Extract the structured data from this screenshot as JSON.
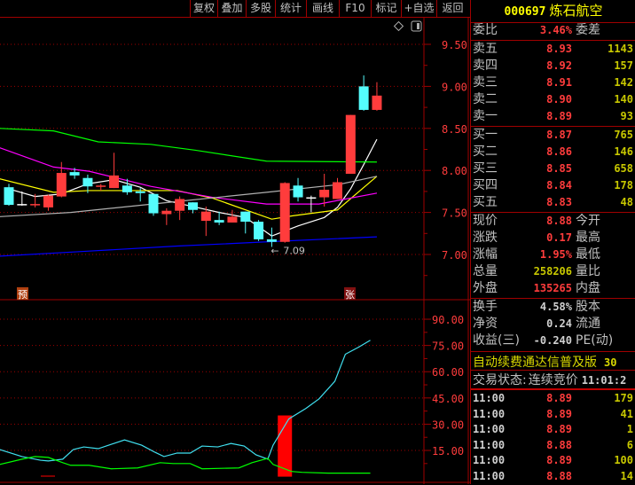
{
  "toolbar": {
    "buttons": [
      "复权",
      "叠加",
      "多股",
      "统计",
      "画线",
      "F10",
      "标记",
      "+自选",
      "返回"
    ]
  },
  "stock": {
    "code": "000697",
    "name": "炼石航空"
  },
  "weibi": {
    "label": "委比",
    "value": "3.46%",
    "label2": "委差"
  },
  "asks": [
    {
      "label": "卖五",
      "price": "8.93",
      "vol": "1143"
    },
    {
      "label": "卖四",
      "price": "8.92",
      "vol": "157"
    },
    {
      "label": "卖三",
      "price": "8.91",
      "vol": "142"
    },
    {
      "label": "卖二",
      "price": "8.90",
      "vol": "140"
    },
    {
      "label": "卖一",
      "price": "8.89",
      "vol": "93"
    }
  ],
  "bids": [
    {
      "label": "买一",
      "price": "8.87",
      "vol": "765"
    },
    {
      "label": "买二",
      "price": "8.86",
      "vol": "146"
    },
    {
      "label": "买三",
      "price": "8.85",
      "vol": "658"
    },
    {
      "label": "买四",
      "price": "8.84",
      "vol": "178"
    },
    {
      "label": "买五",
      "price": "8.83",
      "vol": "48"
    }
  ],
  "quote": [
    {
      "label": "现价",
      "value": "8.88",
      "label2": "今开",
      "color": "red"
    },
    {
      "label": "涨跌",
      "value": "0.17",
      "label2": "最高",
      "color": "red"
    },
    {
      "label": "涨幅",
      "value": "1.95%",
      "label2": "最低",
      "color": "red"
    },
    {
      "label": "总量",
      "value": "258206",
      "label2": "量比",
      "color": "yellow"
    },
    {
      "label": "外盘",
      "value": "135265",
      "label2": "内盘",
      "color": "red"
    }
  ],
  "fund": [
    {
      "label": "换手",
      "value": "4.58%",
      "label2": "股本"
    },
    {
      "label": "净资",
      "value": "0.24",
      "label2": "流通"
    },
    {
      "label": "收益(三)",
      "value": "-0.240",
      "label2": "PE(动)"
    }
  ],
  "promo": {
    "text": "自动续费通达信普及版",
    "extra": "30"
  },
  "status": {
    "label": "交易状态:",
    "value": "连续竞价",
    "time": "11:01:2"
  },
  "ticks": [
    {
      "time": "11:00",
      "price": "8.89",
      "vol": "179"
    },
    {
      "time": "11:00",
      "price": "8.89",
      "vol": "41"
    },
    {
      "time": "11:00",
      "price": "8.89",
      "vol": "1"
    },
    {
      "time": "11:00",
      "price": "8.88",
      "vol": "6"
    },
    {
      "time": "11:00",
      "price": "8.89",
      "vol": "100"
    },
    {
      "time": "11:00",
      "price": "8.88",
      "vol": "14"
    }
  ],
  "markers": {
    "left": "预",
    "right": "张",
    "low_label": "7.09"
  },
  "chart_data": [
    {
      "type": "candlestick",
      "name": "price",
      "ylim": [
        6.85,
        9.6
      ],
      "yticks": [
        "9.50",
        "9.00",
        "8.50",
        "8.00",
        "7.50",
        "7.00"
      ],
      "colors": {
        "up": "#ff3c3c",
        "down": "#54fcfc",
        "flat": "#ffffff"
      },
      "candles": [
        [
          7.8,
          7.59,
          7.84,
          7.58
        ],
        [
          7.6,
          7.6,
          7.75,
          7.58
        ],
        [
          7.6,
          7.6,
          7.72,
          7.56
        ],
        [
          7.56,
          7.7,
          7.71,
          7.52
        ],
        [
          7.69,
          7.97,
          8.1,
          7.68
        ],
        [
          7.98,
          7.94,
          8.03,
          7.9
        ],
        [
          7.91,
          7.81,
          7.95,
          7.73
        ],
        [
          7.81,
          7.82,
          7.84,
          7.76
        ],
        [
          7.79,
          7.94,
          8.21,
          7.79
        ],
        [
          7.82,
          7.74,
          7.9,
          7.71
        ],
        [
          7.75,
          7.73,
          7.79,
          7.63
        ],
        [
          7.72,
          7.49,
          7.72,
          7.46
        ],
        [
          7.48,
          7.52,
          7.55,
          7.35
        ],
        [
          7.52,
          7.66,
          7.69,
          7.41
        ],
        [
          7.62,
          7.53,
          7.62,
          7.49
        ],
        [
          7.4,
          7.51,
          7.57,
          7.22
        ],
        [
          7.41,
          7.38,
          7.51,
          7.35
        ],
        [
          7.38,
          7.45,
          7.53,
          7.38
        ],
        [
          7.51,
          7.39,
          7.51,
          7.25
        ],
        [
          7.39,
          7.18,
          7.41,
          7.16
        ],
        [
          7.18,
          7.15,
          7.32,
          7.09
        ],
        [
          7.15,
          7.85,
          7.86,
          7.14
        ],
        [
          7.82,
          7.68,
          7.91,
          7.63
        ],
        [
          7.68,
          7.68,
          7.7,
          7.5
        ],
        [
          7.68,
          7.77,
          7.96,
          7.57
        ],
        [
          7.66,
          7.86,
          7.91,
          7.66
        ],
        [
          7.96,
          8.66,
          8.66,
          7.96
        ],
        [
          9.0,
          8.72,
          9.13,
          8.71
        ],
        [
          8.72,
          8.89,
          9.05,
          8.71
        ]
      ],
      "lines": [
        {
          "name": "MA5",
          "color": "#ffffff",
          "points": [
            [
              0,
              7.78
            ],
            [
              2,
              7.69
            ],
            [
              4,
              7.72
            ],
            [
              6,
              7.84
            ],
            [
              8,
              7.89
            ],
            [
              10,
              7.8
            ],
            [
              12,
              7.64
            ],
            [
              14,
              7.57
            ],
            [
              16,
              7.5
            ],
            [
              18,
              7.44
            ],
            [
              20,
              7.22
            ],
            [
              22,
              7.34
            ],
            [
              24,
              7.44
            ],
            [
              25,
              7.56
            ],
            [
              26,
              7.78
            ],
            [
              27,
              8.07
            ],
            [
              28,
              8.37
            ]
          ]
        },
        {
          "name": "MA10",
          "color": "#ffff00",
          "points": [
            [
              -0.7,
              7.9
            ],
            [
              3.4,
              7.74
            ],
            [
              6.1,
              7.76
            ],
            [
              12.8,
              7.76
            ],
            [
              15.5,
              7.67
            ],
            [
              20,
              7.42
            ],
            [
              21.6,
              7.46
            ],
            [
              25,
              7.53
            ],
            [
              28,
              7.93
            ]
          ]
        },
        {
          "name": "MA20",
          "color": "#ff00ff",
          "points": [
            [
              -0.7,
              8.27
            ],
            [
              3.4,
              8.04
            ],
            [
              6.1,
              7.99
            ],
            [
              10.8,
              7.81
            ],
            [
              15.5,
              7.68
            ],
            [
              19.6,
              7.6
            ],
            [
              23.6,
              7.6
            ],
            [
              28,
              7.73
            ]
          ]
        },
        {
          "name": "MA30",
          "color": "#b0b0b0",
          "points": [
            [
              -0.7,
              7.45
            ],
            [
              4.7,
              7.5
            ],
            [
              12.8,
              7.63
            ],
            [
              19.6,
              7.74
            ],
            [
              25,
              7.83
            ],
            [
              28,
              7.93
            ]
          ]
        },
        {
          "name": "MA60",
          "color": "#00ff00",
          "points": [
            [
              -0.7,
              8.5
            ],
            [
              3.4,
              8.47
            ],
            [
              6.8,
              8.34
            ],
            [
              10.8,
              8.31
            ],
            [
              14.2,
              8.24
            ],
            [
              19.6,
              8.11
            ],
            [
              28,
              8.1
            ]
          ]
        },
        {
          "name": "MA120",
          "color": "#0000ff",
          "points": [
            [
              -0.7,
              6.98
            ],
            [
              6.1,
              7.04
            ],
            [
              12.8,
              7.1
            ],
            [
              19.6,
              7.15
            ],
            [
              28,
              7.21
            ]
          ]
        }
      ]
    },
    {
      "type": "line",
      "name": "indicator",
      "ylim": [
        0,
        100
      ],
      "yticks": [
        "90.00",
        "75.00",
        "60.00",
        "45.00",
        "30.00",
        "15.00"
      ],
      "bar": {
        "index": 21,
        "value": 35,
        "color": "#ff0000"
      },
      "series": [
        {
          "name": "cyan",
          "color": "#40e0f0",
          "points": [
            [
              -0.7,
              15.5
            ],
            [
              1,
              11.5
            ],
            [
              2.4,
              9.4
            ],
            [
              3,
              9
            ],
            [
              4.1,
              10
            ],
            [
              4.9,
              15.5
            ],
            [
              5.7,
              17
            ],
            [
              6.8,
              16
            ],
            [
              7.8,
              18.5
            ],
            [
              8.8,
              21
            ],
            [
              10.1,
              18
            ],
            [
              11.1,
              14
            ],
            [
              11.8,
              11.5
            ],
            [
              12.8,
              13.5
            ],
            [
              13.8,
              13.5
            ],
            [
              14.7,
              17.5
            ],
            [
              15.9,
              17
            ],
            [
              16.9,
              19
            ],
            [
              17.9,
              17.5
            ],
            [
              18.8,
              12.5
            ],
            [
              19.7,
              10
            ],
            [
              20.1,
              18
            ],
            [
              21.3,
              33
            ],
            [
              22.6,
              39
            ],
            [
              23.6,
              44.5
            ],
            [
              24.8,
              54.5
            ],
            [
              25.6,
              70
            ],
            [
              26.6,
              74
            ],
            [
              27.5,
              78
            ]
          ]
        },
        {
          "name": "green",
          "color": "#00ff00",
          "points": [
            [
              -0.7,
              7
            ],
            [
              1,
              10
            ],
            [
              2,
              11.5
            ],
            [
              3,
              11
            ],
            [
              4.1,
              8
            ],
            [
              4.7,
              6.5
            ],
            [
              6.1,
              6.5
            ],
            [
              7.8,
              4.5
            ],
            [
              9.8,
              5
            ],
            [
              11.5,
              8
            ],
            [
              12.5,
              7.5
            ],
            [
              13.8,
              7.5
            ],
            [
              14.7,
              4.5
            ],
            [
              17.5,
              5
            ],
            [
              18.5,
              8
            ],
            [
              19.7,
              10.5
            ],
            [
              20.1,
              7
            ],
            [
              21.5,
              3
            ],
            [
              22.3,
              2.5
            ],
            [
              24.3,
              2
            ],
            [
              27.5,
              2
            ]
          ]
        }
      ]
    }
  ]
}
